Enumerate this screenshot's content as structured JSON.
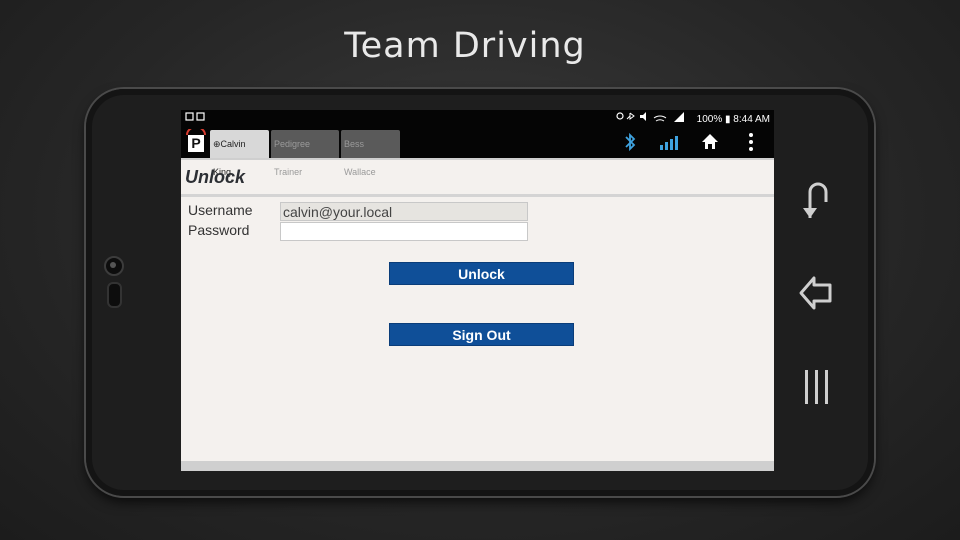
{
  "slide": {
    "title": "Team Driving"
  },
  "status_bar": {
    "left_icons": [
      "image-icon",
      "screen-icon"
    ],
    "battery": "100%",
    "time": "8:44 AM",
    "right_icons": [
      "location-icon",
      "bluetooth-icon",
      "mute-icon",
      "wifi-icon",
      "signal-icon",
      "battery-icon"
    ]
  },
  "app_bar": {
    "logo": "P",
    "tabs": [
      {
        "label": "⊕Calvin King",
        "active": true
      },
      {
        "label": "Pedigree Trainer",
        "active": false
      },
      {
        "label": "Bess Wallace",
        "active": false
      }
    ],
    "icons": [
      "bluetooth-icon",
      "signal-bars-icon",
      "home-icon",
      "more-vert-icon"
    ]
  },
  "page": {
    "title": "Unlock",
    "username_label": "Username",
    "username_value": "calvin@your.local",
    "password_label": "Password",
    "password_value": "",
    "unlock_button": "Unlock",
    "signout_button": "Sign Out"
  },
  "hardware_buttons": [
    "back-arrow-icon",
    "home-arrow-icon",
    "recent-apps-icon"
  ],
  "colors": {
    "button": "#0f4f98",
    "screen_bg": "#f4f1ee",
    "app_bar": "#050505",
    "bluetooth_icon": "#3fa3e0"
  }
}
